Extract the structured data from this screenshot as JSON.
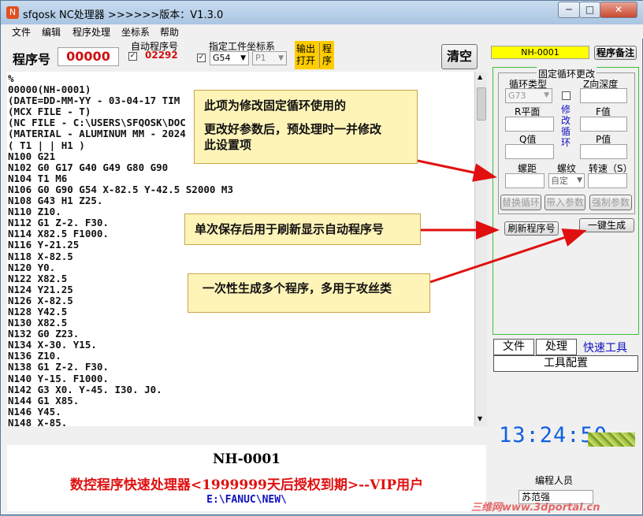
{
  "window": {
    "title": "sfqosk NC处理器 >>>>>>版本：V1.3.0",
    "controls": {
      "minimize": "─",
      "maximize": "□",
      "close": "✕"
    }
  },
  "menu": [
    "文件",
    "编辑",
    "程序处理",
    "坐标系",
    "帮助"
  ],
  "toolbar": {
    "program_no_label": "程序号",
    "program_no_value": "00000",
    "auto_program_label": "自动程序号",
    "auto_program_value": "02292",
    "workpiece_coord_label": "指定工件坐标系",
    "coord_value": "G54",
    "coord_sub_value": "P1",
    "output_open": [
      "输出",
      "打开"
    ],
    "program_tag": [
      "程",
      "序"
    ],
    "clear_button": "清空"
  },
  "code_lines": [
    "%",
    "00000(NH-0001)",
    "(DATE=DD-MM-YY - 03-04-17 TIM",
    "(MCX FILE - T)",
    "(NC FILE - C:\\USERS\\SFQOSK\\DOC",
    "(MATERIAL - ALUMINUM MM - 2024",
    "( T1 | | H1 )",
    "N100 G21",
    "N102 G0 G17 G40 G49 G80 G90",
    "N104 T1 M6",
    "N106 G0 G90 G54 X-82.5 Y-42.5 S2000 M3",
    "N108 G43 H1 Z25.",
    "N110 Z10.",
    "N112 G1 Z-2. F30.",
    "N114 X82.5 F1000.",
    "N116 Y-21.25",
    "N118 X-82.5",
    "N120 Y0.",
    "N122 X82.5",
    "N124 Y21.25",
    "N126 X-82.5",
    "N128 Y42.5",
    "N130 X82.5",
    "N132 G0 Z23.",
    "N134 X-30. Y15.",
    "N136 Z10.",
    "N138 G1 Z-2. F30.",
    "N140 Y-15. F1000.",
    "N142 G3 X0. Y-45. I30. J0.",
    "N144 G1 X85.",
    "N146 Y45.",
    "N148 X-85."
  ],
  "status": {
    "program_name": "NH-0001",
    "license": "数控程序快速处理器<1999999天后授权到期>--VIP用户",
    "path": "E:\\FANUC\\NEW\\"
  },
  "callouts": {
    "one": [
      "此项为修改固定循环使用的",
      "更改好参数后，预处理时一并修改",
      "此设置项"
    ],
    "two": "单次保存后用于刷新显示自动程序号",
    "three": "一次性生成多个程序，多用于攻丝类"
  },
  "right": {
    "program_field": "NH-0001",
    "remark_button": "程序备注",
    "cycle_group_title": "固定循环更改",
    "cycle_type_label": "循环类型",
    "z_depth_label": "Z向深度",
    "cycle_type_value": "G73",
    "modify_cycle": [
      "修",
      "改",
      "循",
      "环"
    ],
    "r_plane_label": "R平面",
    "f_value_label": "F值",
    "q_value_label": "Q值",
    "p_value_label": "P值",
    "pitch_label": "螺距",
    "thread_label": "螺纹",
    "speed_label": "转速（S）",
    "thread_value": "自定",
    "replace_cycle": "替换循环",
    "insert_param": "带入参数",
    "force_param": "强制参数",
    "refresh_program": "刷新程序号",
    "one_key_generate": "一键生成",
    "tabs": [
      "文件",
      "处理",
      "快速工具"
    ],
    "tool_config": "工具配置",
    "clock": "13:24:50",
    "programmer_label": "编程人员",
    "programmer_value": "苏范强"
  },
  "watermark": "三维网www.3dportal.cn",
  "colors": {
    "callout_bg": "#fff4b8",
    "arrow": "#e01010",
    "program_field_bg": "#ffff00",
    "clock": "#1060e0",
    "license_text": "#e01010",
    "path_text": "#1010c0",
    "quick_tools": "#1010c0",
    "auto_program_value": "#d01010",
    "program_no_value": "#d01010",
    "group_border": "#3cc03c"
  }
}
